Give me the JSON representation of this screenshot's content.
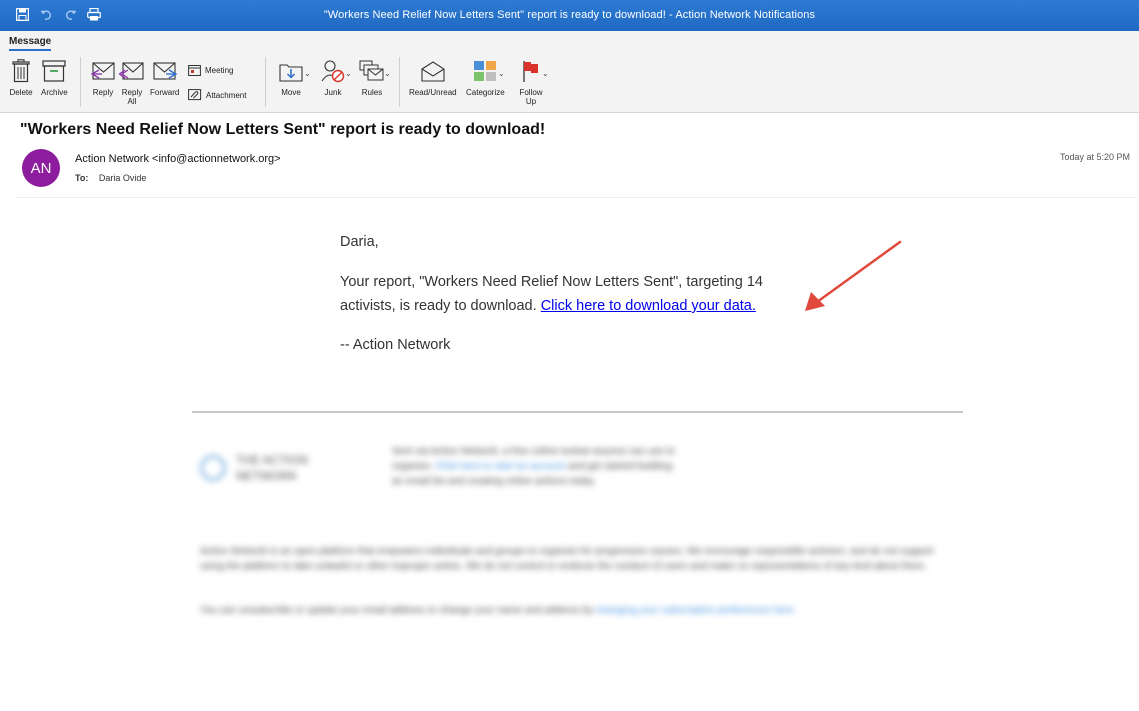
{
  "window": {
    "title": "\"Workers Need Relief Now Letters Sent\" report is ready to download! - Action Network Notifications"
  },
  "ribbon": {
    "tab": "Message",
    "buttons": {
      "delete": "Delete",
      "archive": "Archive",
      "reply": "Reply",
      "reply_all_line1": "Reply",
      "reply_all_line2": "All",
      "forward": "Forward",
      "meeting": "Meeting",
      "attachment": "Attachment",
      "move": "Move",
      "junk": "Junk",
      "rules": "Rules",
      "read_unread": "Read/Unread",
      "categorize": "Categorize",
      "follow_up_line1": "Follow",
      "follow_up_line2": "Up"
    },
    "icons": [
      "save-icon",
      "undo-icon",
      "redo-icon",
      "print-icon",
      "trash-icon",
      "archive-icon",
      "reply-icon",
      "reply-all-icon",
      "forward-icon",
      "calendar-icon",
      "paperclip-icon",
      "move-icon",
      "junk-icon",
      "rules-icon",
      "envelope-open-icon",
      "categorize-icon",
      "flag-icon"
    ],
    "colors": {
      "flag": "#d9322b",
      "categorize": [
        "#4a90d9",
        "#f0a64a",
        "#7ac36a",
        "#bfbfbf"
      ]
    }
  },
  "email": {
    "subject": "\"Workers Need Relief Now Letters Sent\" report is ready to download!",
    "avatar_initials": "AN",
    "avatar_color": "#8e1c9e",
    "sender": "Action Network <info@actionnetwork.org>",
    "to_label": "To:",
    "to_value": "Daria Ovide",
    "date": "Today at 5:20 PM",
    "body": {
      "greeting": "Daria,",
      "paragraph_text": "Your report, \"Workers Need Relief Now Letters Sent\", targeting 14 activists, is ready to download. ",
      "link_text": "Click here to download your data.",
      "signature": "-- Action Network"
    },
    "annotation_arrow_color": "#e04a3c"
  },
  "footer_blurred": {
    "logo_text": "THE ACTION NETWORK",
    "promo_text": "Sent via Action Network, a free online toolset anyone can use to organize. ",
    "promo_link": "Click here to start an account",
    "promo_text_2": " and get started building an email list and creating online actions today.",
    "legal": "Action Network is an open platform that empowers individuals and groups to organize for progressive causes. We encourage responsible activism, and do not support using the platform to take unlawful or other improper action. We do not control or endorse the conduct of users and make no representations of any kind about them.",
    "unsub_text": "You can unsubscribe or update your email address or change your name and address by ",
    "unsub_link": "changing your subscription preferences here."
  }
}
